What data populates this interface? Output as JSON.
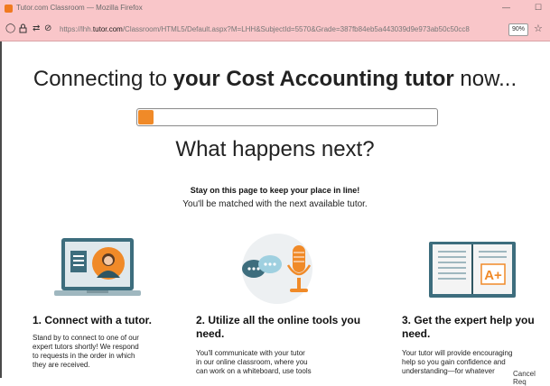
{
  "browser": {
    "window_title": "Tutor.com Classroom — Mozilla Firefox",
    "url_prefix": "https://lhh.",
    "url_domain": "tutor.com",
    "url_rest": "/Classroom/HTML5/Default.aspx?M=LHH&SubjectId=5570&Grade=387fb84eb5a443039d9e973ab50c50cc8",
    "zoom": "90%",
    "minimize_glyph": "—",
    "maximize_glyph": "☐"
  },
  "main": {
    "headline_pre": "Connecting to ",
    "headline_bold": "your Cost Accounting tutor",
    "headline_post": " now...",
    "progress_fraction": 0.05,
    "subhead": "What happens next?",
    "stay_text": "Stay on this page to keep your place in line!",
    "matched_text": "You'll be matched with the next available tutor."
  },
  "steps": [
    {
      "title": "1. Connect with a tutor.",
      "body": [
        "Stand by to connect to one of our",
        "expert tutors shortly! We respond",
        "to requests in the order in which",
        "they are received."
      ]
    },
    {
      "title_line1": "2. Utilize all the online tools you",
      "title_line2": "need.",
      "body": [
        "You'll communicate with your tutor",
        "in our online classroom, where you",
        "can work on a whiteboard, use tools"
      ]
    },
    {
      "title_line1": "3. Get the expert help you",
      "title_line2": "need.",
      "body": [
        "Your tutor will provide encouraging",
        "help so you gain confidence and",
        "understanding—for whatever"
      ]
    }
  ],
  "footer": {
    "cancel": "Cancel Req"
  },
  "colors": {
    "accent": "#f08a28",
    "browser_chrome": "#f9c6c9",
    "illustration_teal": "#3d6d7d"
  }
}
